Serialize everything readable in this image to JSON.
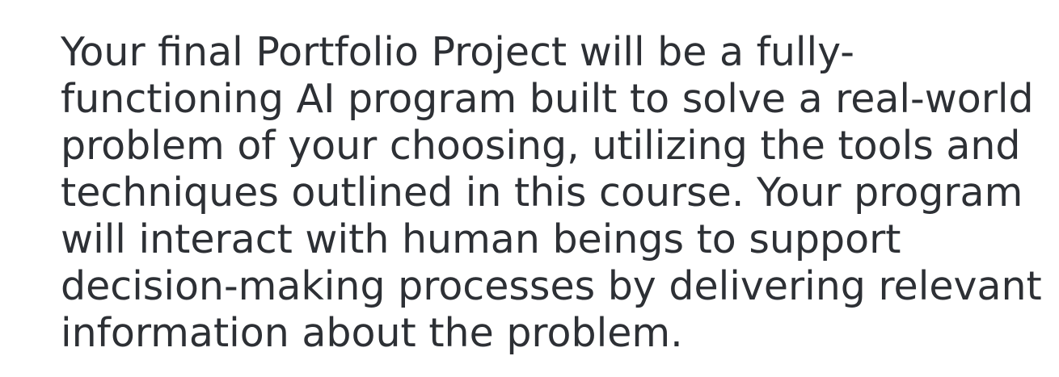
{
  "paragraph": {
    "lines": [
      "Your final Portfolio Project will be a fully-",
      "functioning AI program built to solve a real-world",
      "problem of your choosing, utilizing the tools and",
      "techniques outlined in this course. Your program",
      "will interact with human beings to support",
      "decision-making processes by delivering relevant",
      "information about the problem."
    ]
  },
  "colors": {
    "text": "#2d3035",
    "background": "#ffffff"
  }
}
